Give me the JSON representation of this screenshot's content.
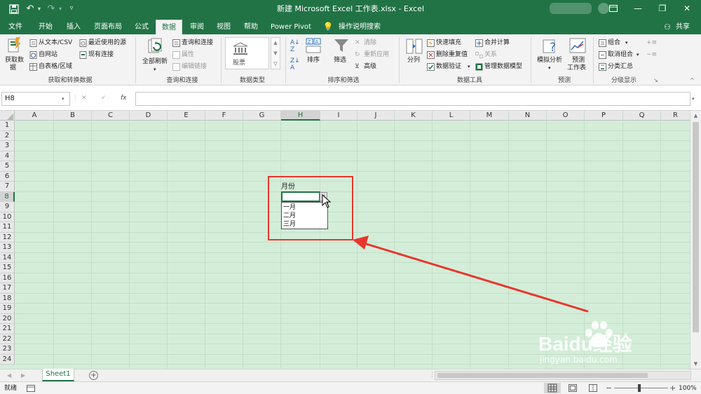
{
  "window": {
    "title": "新建 Microsoft Excel 工作表.xlsx  -  Excel",
    "quick_access": {
      "save_icon": "save-icon",
      "undo_icon": "undo-icon",
      "redo_icon": "redo-icon",
      "customize_icon": "customize-icon"
    },
    "controls": {
      "ribbon_display_icon": "ribbon-display-icon",
      "minimize": "—",
      "restore": "❐",
      "close": "✕"
    }
  },
  "ribbon_tabs": [
    "文件",
    "开始",
    "插入",
    "页面布局",
    "公式",
    "数据",
    "审阅",
    "视图",
    "帮助",
    "Power Pivot"
  ],
  "active_tab": "数据",
  "tell_me": "操作说明搜索",
  "share": "共享",
  "groups": {
    "get_transform": {
      "label": "获取和转换数据",
      "get_data_line1": "获取数",
      "get_data_line2": "据",
      "from_text_csv": "从文本/CSV",
      "from_web": "自网站",
      "from_table": "自表格/区域",
      "recent_sources": "最近使用的源",
      "existing_connections": "现有连接"
    },
    "queries": {
      "label": "查询和连接",
      "refresh_all": "全部刷新",
      "queries_connections": "查询和连接",
      "properties": "属性",
      "edit_links": "编辑链接"
    },
    "data_types": {
      "label": "数据类型",
      "stocks": "股票"
    },
    "sort_filter": {
      "label": "排序和筛选",
      "sort": "排序",
      "filter": "筛选",
      "clear": "清除",
      "reapply": "重新应用",
      "advanced": "高级"
    },
    "data_tools": {
      "label": "数据工具",
      "text_to_columns": "分列",
      "flash_fill": "快速填充",
      "remove_duplicates": "删除重复值",
      "data_validation": "数据验证",
      "consolidate": "合并计算",
      "relationships": "关系",
      "manage_data_model": "管理数据模型"
    },
    "forecast": {
      "label": "预测",
      "what_if": "模拟分析",
      "forecast_sheet_line1": "预测",
      "forecast_sheet_line2": "工作表"
    },
    "outline": {
      "label": "分级显示",
      "group": "组合",
      "ungroup": "取消组合",
      "subtotal": "分类汇总"
    }
  },
  "formula_bar": {
    "name_box": "H8",
    "cancel": "✕",
    "enter": "✓",
    "fx": "fx",
    "value": ""
  },
  "columns": [
    "A",
    "B",
    "C",
    "D",
    "E",
    "F",
    "G",
    "H",
    "I",
    "J",
    "K",
    "L",
    "M",
    "N",
    "O",
    "P",
    "Q",
    "R"
  ],
  "rows": [
    "1",
    "2",
    "3",
    "4",
    "5",
    "6",
    "7",
    "8",
    "9",
    "10",
    "11",
    "12",
    "13",
    "14",
    "15",
    "16",
    "17",
    "18",
    "19",
    "20",
    "21",
    "22",
    "23",
    "24"
  ],
  "selected_cell": {
    "column": "H",
    "row": "8"
  },
  "cells": {
    "H7": "月份"
  },
  "dropdown": {
    "options": [
      "一月",
      "二月",
      "三月"
    ]
  },
  "watermark": {
    "brand": "Baidu经验",
    "url": "jingyan.baidu.com"
  },
  "sheet_tabs": [
    "Sheet1"
  ],
  "status": {
    "ready": "就绪",
    "zoom": "100%",
    "zoom_minus": "−",
    "zoom_plus": "+"
  },
  "colors": {
    "excel_green": "#217346",
    "grid_fill": "#d4edd8",
    "highlight_red": "#e8362e"
  }
}
